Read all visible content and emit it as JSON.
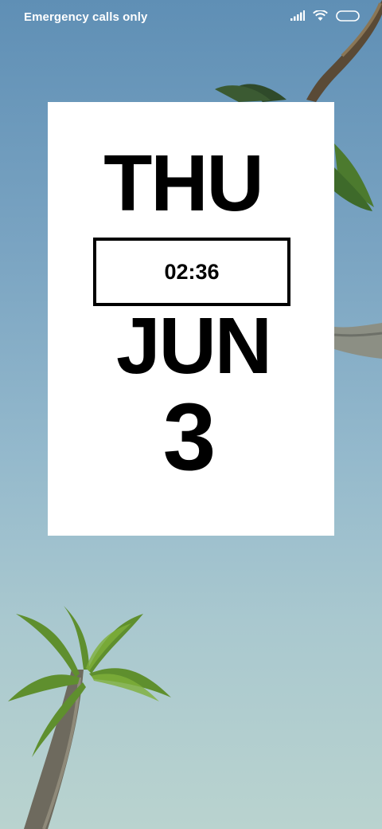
{
  "status_bar": {
    "carrier": "Emergency calls only",
    "icons": [
      "signal-icon",
      "wifi-icon",
      "battery-icon"
    ]
  },
  "widget": {
    "day": "THU",
    "time": "02:36",
    "month": "JUN",
    "date": "3"
  },
  "wallpaper": {
    "subject": "palm-trees-sky"
  },
  "colors": {
    "sky_top": "#5f8fb5",
    "sky_bottom": "#b9d3cf",
    "widget_bg": "#ffffff",
    "text": "#000000"
  }
}
